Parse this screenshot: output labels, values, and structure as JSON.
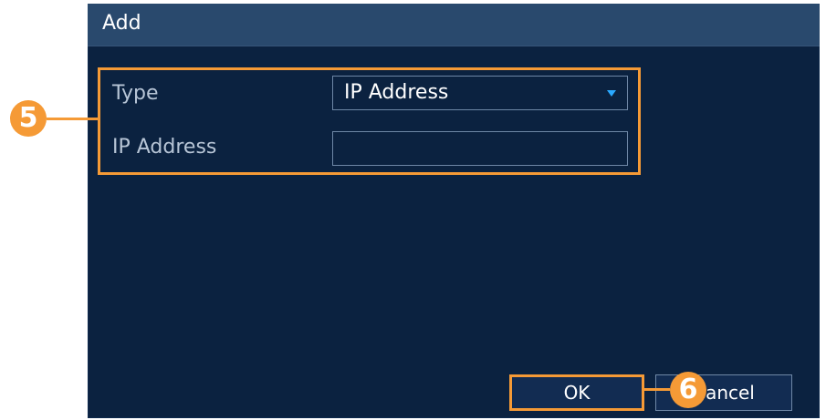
{
  "dialog": {
    "title": "Add"
  },
  "form": {
    "type_label": "Type",
    "type_value": "IP Address",
    "ip_label": "IP Address",
    "ip_value": ""
  },
  "buttons": {
    "ok": "OK",
    "cancel": "Cancel"
  },
  "callouts": {
    "step_5": "5",
    "step_6": "6"
  },
  "colors": {
    "accent": "#f59a36",
    "dialog_background": "#0b2240",
    "titlebar": "#29496d",
    "input_border": "#6e87a6",
    "dropdown_arrow": "#2aa9ff"
  },
  "icons": {
    "dropdown": "chevron-down-icon"
  }
}
